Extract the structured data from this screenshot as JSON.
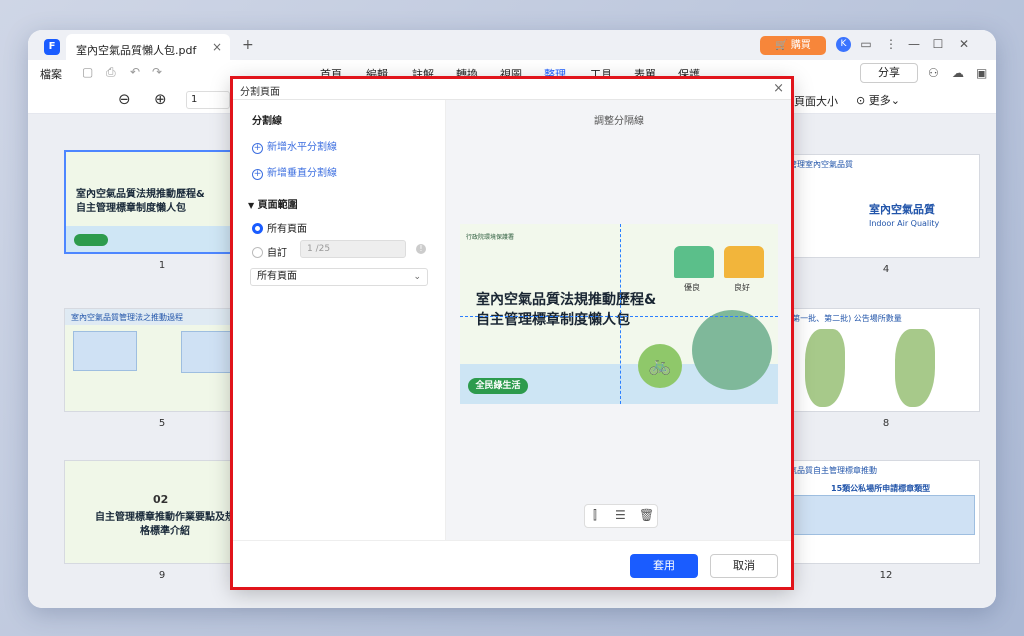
{
  "app": {
    "tab_title": "室內空氣品質懶人包.pdf",
    "buy_label": "購買",
    "avatar_initial": "K"
  },
  "menubar": {
    "file": "檔案",
    "items": [
      "首頁",
      "編輯",
      "註解",
      "轉換",
      "視圖",
      "整理",
      "工具",
      "表單",
      "保護"
    ],
    "active": "整理",
    "share": "分享"
  },
  "toolbar": {
    "page_value": "1",
    "page_size": "頁面大小",
    "more": "更多"
  },
  "thumbnails": {
    "p1_title": "室內空氣品質法規推動歷程&\n自主管理標章制度懶人包",
    "p5_title": "室內空氣品質管理法之推動過程",
    "p9_num": "02",
    "p9_title": "自主管理標章推動作業要點及規\n格標準介紹",
    "p4_title": "管理室內空氣品質",
    "p4_sub": "室內空氣品質",
    "p4_sub_en": "Indoor Air Quality",
    "p8_title": "(第一批、第二批) 公告場所數量",
    "p12_title": "氣品質自主管理標章推動",
    "p12_sub": "15類公私場所申請標章類型",
    "labels": [
      "1",
      "5",
      "9",
      "4",
      "8",
      "12"
    ]
  },
  "dialog": {
    "title": "分割頁面",
    "split_lines_title": "分割線",
    "add_horizontal": "新增水平分割線",
    "add_vertical": "新增垂直分割線",
    "page_range_title": "頁面範圍",
    "all_pages": "所有頁面",
    "custom": "自訂",
    "range_placeholder": "1 /25",
    "select_value": "所有頁面",
    "adjust_label": "調整分隔線",
    "apply": "套用",
    "cancel": "取消"
  },
  "preview": {
    "title": "室內空氣品質法規推動歷程&\n自主管理標章制度懶人包",
    "org": "行政院環境保護署",
    "house1": "優良",
    "house2": "良好",
    "tag": "全民綠生活"
  },
  "colors": {
    "accent": "#1a5cff",
    "highlight": "#e1141b",
    "buy": "#f7863a"
  }
}
